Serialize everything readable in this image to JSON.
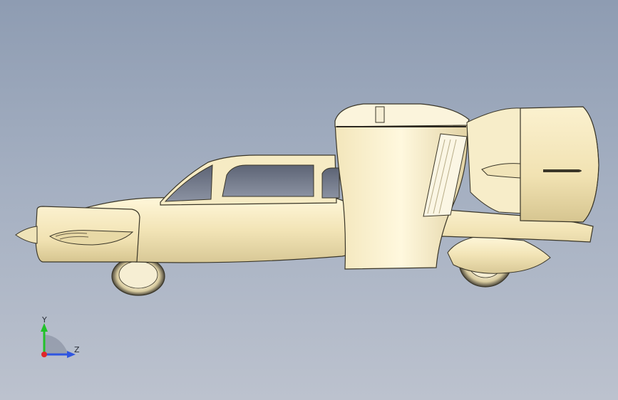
{
  "viewport": {
    "background_top": "#8e9cb2",
    "background_bottom": "#bcc2ce",
    "model_color": "#f3e7bd",
    "model_outline": "#3a3628",
    "glass_color": "#6f7688"
  },
  "triad": {
    "y_label": "Y",
    "z_label": "Z",
    "y_color": "#22c22a",
    "z_color": "#2f55e0",
    "x_color": "#e0262a"
  }
}
